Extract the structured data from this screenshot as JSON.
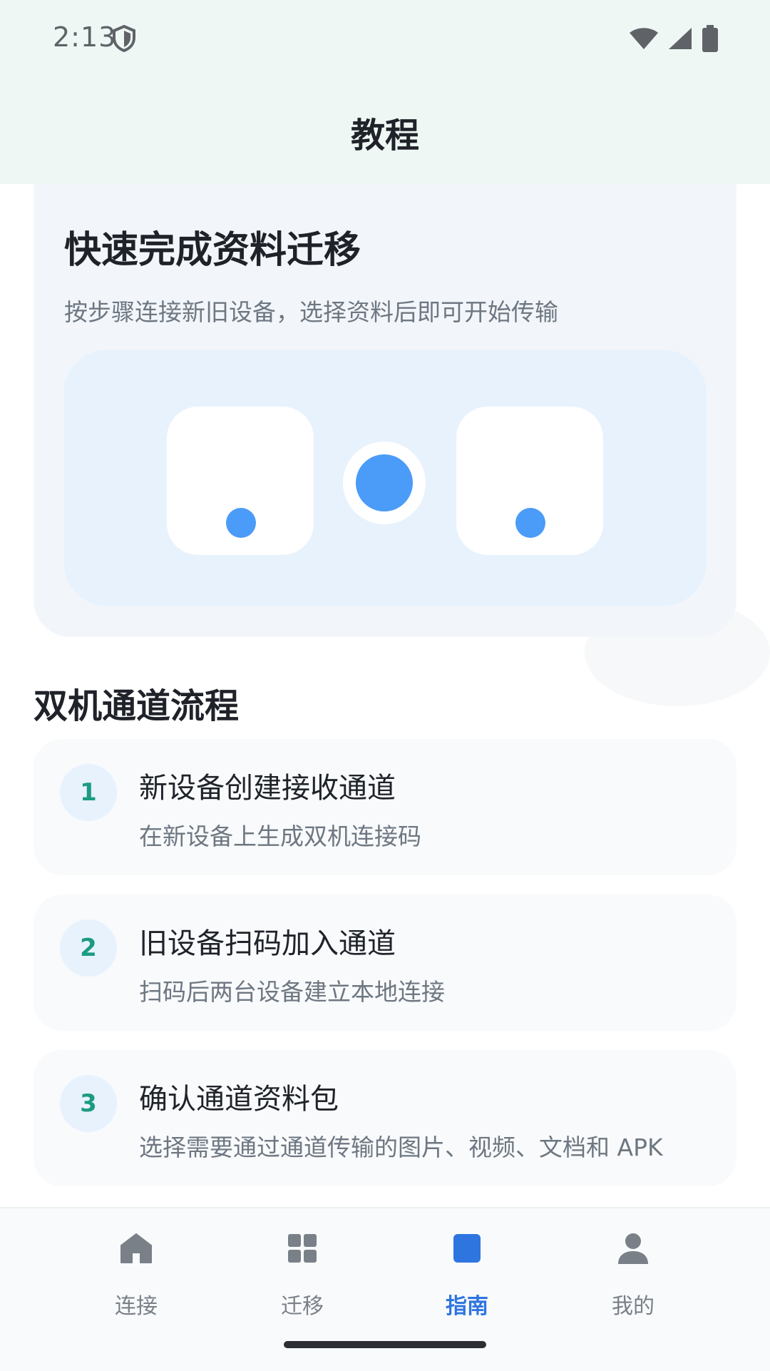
{
  "status_bar": {
    "time": "2:13"
  },
  "app_bar": {
    "title": "教程"
  },
  "hero": {
    "title": "快速完成资料迁移",
    "subtitle": "按步骤连接新旧设备，选择资料后即可开始传输"
  },
  "section": {
    "title": "双机通道流程"
  },
  "steps": [
    {
      "number": "1",
      "title": "新设备创建接收通道",
      "description": "在新设备上生成双机连接码"
    },
    {
      "number": "2",
      "title": "旧设备扫码加入通道",
      "description": "扫码后两台设备建立本地连接"
    },
    {
      "number": "3",
      "title": "确认通道资料包",
      "description": "选择需要通过通道传输的图片、视频、文档和 APK"
    }
  ],
  "bottom_nav": {
    "items": [
      {
        "label": "连接",
        "icon": "home-icon",
        "active": false
      },
      {
        "label": "迁移",
        "icon": "grid-icon",
        "active": false
      },
      {
        "label": "指南",
        "icon": "book-icon",
        "active": true
      },
      {
        "label": "我的",
        "icon": "person-icon",
        "active": false
      }
    ]
  },
  "colors": {
    "accent": "#2e75e0",
    "step_number": "#1b9b82",
    "illustration_blue": "#4b9bf8",
    "top_background": "#eef7f4"
  }
}
